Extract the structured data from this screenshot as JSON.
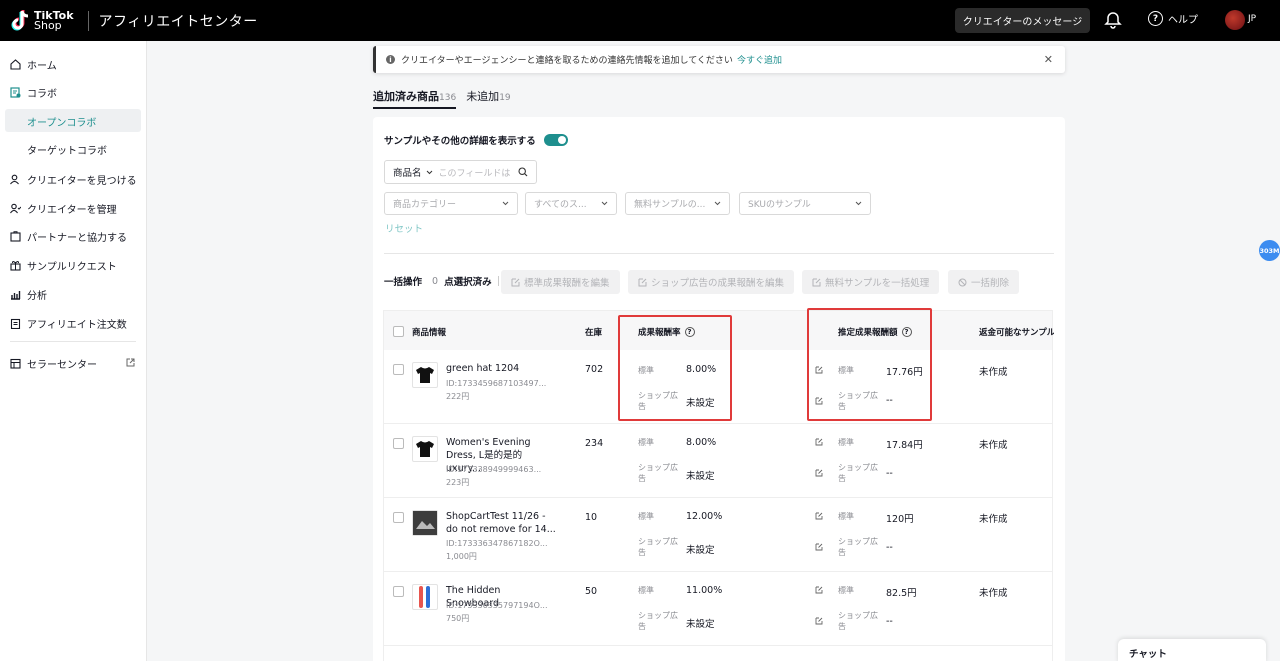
{
  "header": {
    "logo_top": "TikTok",
    "logo_bottom": "Shop",
    "app_title": "アフィリエイトセンター",
    "messages_button": "クリエイターのメッセージ",
    "help_label": "ヘルプ",
    "language": "JP"
  },
  "sidebar": {
    "home": "ホーム",
    "collab": "コラボ",
    "open_collab": "オープンコラボ",
    "target_collab": "ターゲットコラボ",
    "find_creators": "クリエイターを見つける",
    "manage_creators": "クリエイターを管理",
    "partners": "パートナーと協力する",
    "sample_requests": "サンプルリクエスト",
    "analytics": "分析",
    "affiliate_orders": "アフィリエイト注文数",
    "seller_center": "セラーセンター"
  },
  "notice": {
    "text": "クリエイターやエージェンシーと連絡を取るための連絡先情報を追加してください",
    "link": "今すぐ追加"
  },
  "tabs": [
    {
      "label": "追加済み商品",
      "count": "136"
    },
    {
      "label": "未追加",
      "count": "19"
    }
  ],
  "filters": {
    "toggle_label": "サンプルやその他の詳細を表示する",
    "search_select": "商品名",
    "search_placeholder": "このフィールドは",
    "category": "商品カテゴリー",
    "status": "すべてのス...",
    "free_sample": "無料サンプルの...",
    "sku_sample": "SKUのサンプル",
    "reset": "リセット"
  },
  "bulk": {
    "label": "一括操作",
    "count": "0",
    "selected": "点選択済み",
    "edit_standard": "標準成果報酬を編集",
    "edit_shop_ads": "ショップ広告の成果報酬を編集",
    "bulk_free_sample": "無料サンプルを一括処理",
    "bulk_delete": "一括削除"
  },
  "table": {
    "headers": {
      "product": "商品情報",
      "stock": "在庫",
      "commission_rate": "成果報酬率",
      "est_commission": "推定成果報酬額",
      "refundable_sample": "返金可能なサンプル"
    },
    "standard_label": "標準",
    "shop_ads_label_1": "ショップ広",
    "shop_ads_label_2": "告",
    "rows": [
      {
        "name": "green hat 1204",
        "id": "ID:1733459687103497...",
        "price": "222円",
        "stock": "702",
        "rate_std": "8.00%",
        "rate_ads": "未設定",
        "est_std": "17.76円",
        "est_ads": "--",
        "sample": "未作成"
      },
      {
        "name": "Women's Evening Dress, L是的是的uxury...",
        "id": "ID:173338949999463...",
        "price": "223円",
        "stock": "234",
        "rate_std": "8.00%",
        "rate_ads": "未設定",
        "est_std": "17.84円",
        "est_ads": "--",
        "sample": "未作成"
      },
      {
        "name": "ShopCartTest 11/26 - do not remove for 14...",
        "id": "ID:173336347867182О...",
        "price": "1,000円",
        "stock": "10",
        "rate_std": "12.00%",
        "rate_ads": "未設定",
        "est_std": "120円",
        "est_ads": "--",
        "sample": "未作成"
      },
      {
        "name": "The Hidden Snowboard",
        "id": "ID:173336335797194О...",
        "price": "750円",
        "stock": "50",
        "rate_std": "11.00%",
        "rate_ads": "未設定",
        "est_std": "82.5円",
        "est_ads": "--",
        "sample": "未作成"
      }
    ]
  },
  "floating_badge": "303M",
  "chat_label": "チャット"
}
